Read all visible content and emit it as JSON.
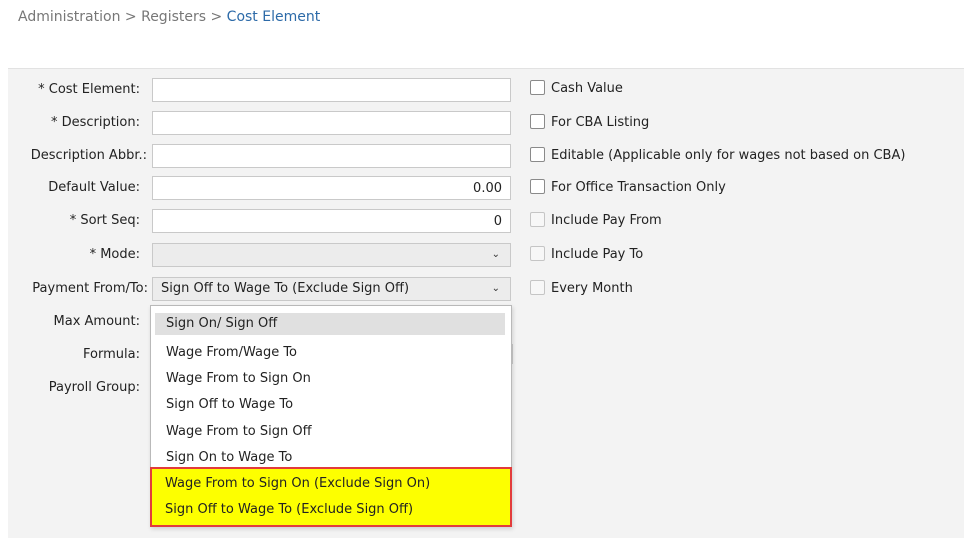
{
  "breadcrumb": {
    "part1": "Administration",
    "sep1": " > ",
    "part2": "Registers",
    "sep2": " > ",
    "current": "Cost Element"
  },
  "form": {
    "cost_element_label": "* Cost Element:",
    "cost_element_value": "",
    "description_label": "* Description:",
    "description_value": "",
    "description_abbr_label": "Description Abbr.:",
    "description_abbr_value": "",
    "default_value_label": "Default Value:",
    "default_value_value": "0.00",
    "sort_seq_label": "* Sort Seq:",
    "sort_seq_value": "0",
    "mode_label": "* Mode:",
    "mode_value": "",
    "payment_label": "Payment From/To:",
    "payment_value": "Sign Off to Wage To (Exclude Sign Off)",
    "max_amount_label": "Max Amount:",
    "formula_label": "Formula:",
    "payroll_group_label": "Payroll Group:"
  },
  "checkboxes": {
    "cash_value": "Cash Value",
    "cba_listing": "For CBA Listing",
    "editable": "Editable (Applicable only for wages not based on CBA)",
    "office_only": "For Office Transaction Only",
    "pay_from": "Include Pay From",
    "pay_to": "Include Pay To",
    "every_month": "Every Month"
  },
  "dropdown": {
    "options": [
      "Sign On/ Sign Off",
      "Wage From/Wage To",
      "Wage From to Sign On",
      "Sign Off to Wage To",
      "Wage From to Sign Off",
      "Sign On to Wage To",
      "Wage From to Sign On (Exclude Sign On)",
      "Sign Off to Wage To (Exclude Sign Off)"
    ]
  },
  "colors": {
    "highlight_fill": "#fdff00",
    "highlight_border": "#e23b3b",
    "breadcrumb_current": "#2c6aa8"
  },
  "icons": {
    "select_chevron": "chevron-down-icon"
  }
}
